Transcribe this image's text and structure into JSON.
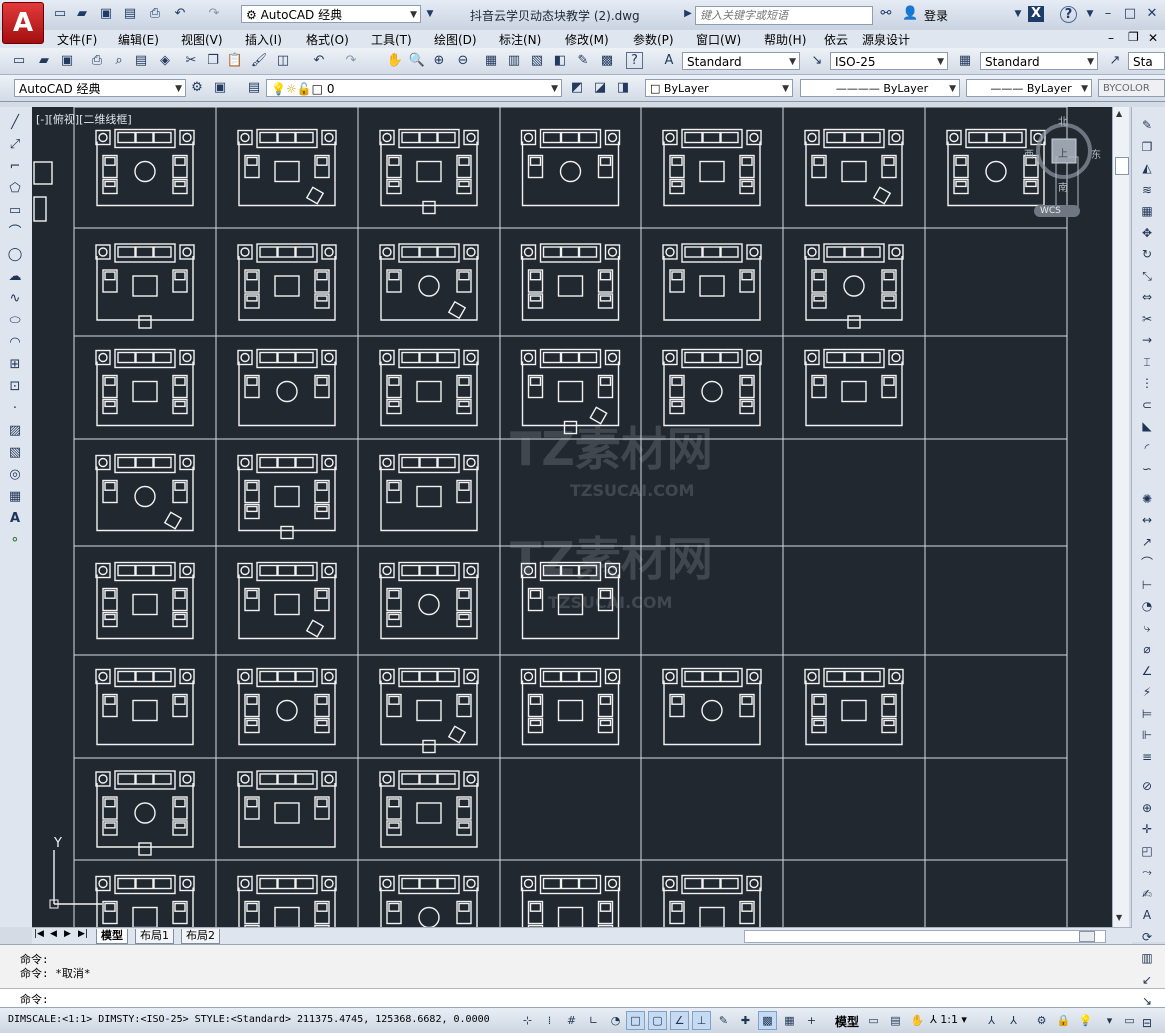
{
  "app": {
    "logo_letter": "A",
    "workspace": "AutoCAD 经典",
    "doc_title": "抖音云学贝动态块教学 (2).dwg",
    "search_placeholder": "键入关键字或短语",
    "login": "登录",
    "help": "?"
  },
  "menu": [
    "文件(F)",
    "编辑(E)",
    "视图(V)",
    "插入(I)",
    "格式(O)",
    "工具(T)",
    "绘图(D)",
    "标注(N)",
    "修改(M)",
    "参数(P)",
    "窗口(W)",
    "帮助(H)",
    "依云",
    "源泉设计"
  ],
  "toolbar1": {
    "text_style": "Standard",
    "dim_style": "ISO-25",
    "table_style": "Standard",
    "mleader_style": "Sta"
  },
  "toolbar2": {
    "workspace": "AutoCAD 经典",
    "layer": "0",
    "color": "ByLayer",
    "linetype": "ByLayer",
    "lineweight": "ByLayer",
    "plotstyle": "BYCOLOR"
  },
  "viewport": {
    "label": "[-][俯视][二维线框]",
    "viewcube": {
      "north": "北",
      "south": "南",
      "east": "东",
      "west": "西",
      "top": "上",
      "wcs": "WCS"
    }
  },
  "watermark": {
    "brand": "TZ素材网",
    "url": "TZSUCAI.COM"
  },
  "ucs": {
    "y": "Y"
  },
  "tabs": [
    "模型",
    "布局1",
    "布局2"
  ],
  "command": {
    "history": [
      "命令:",
      "命令: *取消*"
    ],
    "prompt": "命令:"
  },
  "status": {
    "text": "DIMSCALE:<1:1> DIMSTY:<ISO-25> STYLE:<Standard>  211375.4745, 125368.6682, 0.0000",
    "model": "模型",
    "scale": "1:1"
  },
  "drawing": {
    "grid_rows": 8,
    "grid_cols": 7,
    "layout_counts": [
      7,
      6,
      6,
      3,
      4,
      6,
      3,
      5
    ]
  }
}
